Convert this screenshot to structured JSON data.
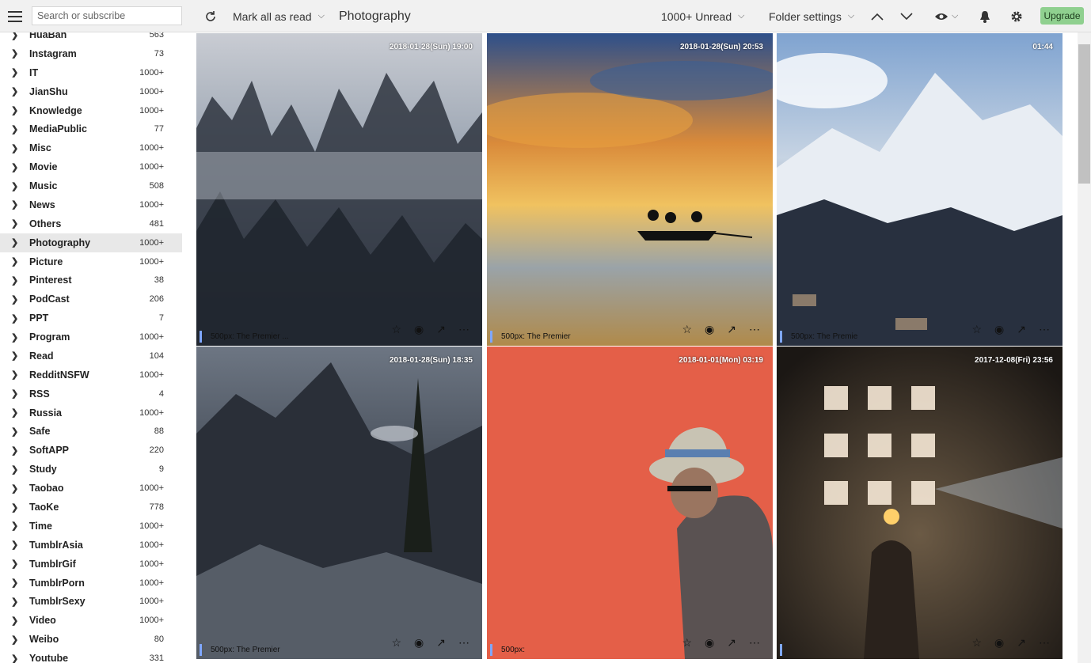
{
  "toolbar": {
    "search_placeholder": "Search or subscribe",
    "mark_all_label": "Mark all as read",
    "page_title": "Photography",
    "unread_label": "1000+ Unread",
    "folder_settings_label": "Folder settings",
    "upgrade_label": "Upgrade"
  },
  "sidebar": {
    "items": [
      {
        "label": "HuaBan",
        "count": "563"
      },
      {
        "label": "Instagram",
        "count": "73"
      },
      {
        "label": "IT",
        "count": "1000+"
      },
      {
        "label": "JianShu",
        "count": "1000+"
      },
      {
        "label": "Knowledge",
        "count": "1000+"
      },
      {
        "label": "MediaPublic",
        "count": "77"
      },
      {
        "label": "Misc",
        "count": "1000+"
      },
      {
        "label": "Movie",
        "count": "1000+"
      },
      {
        "label": "Music",
        "count": "508"
      },
      {
        "label": "News",
        "count": "1000+"
      },
      {
        "label": "Others",
        "count": "481"
      },
      {
        "label": "Photography",
        "count": "1000+",
        "active": true
      },
      {
        "label": "Picture",
        "count": "1000+"
      },
      {
        "label": "Pinterest",
        "count": "38"
      },
      {
        "label": "PodCast",
        "count": "206"
      },
      {
        "label": "PPT",
        "count": "7"
      },
      {
        "label": "Program",
        "count": "1000+"
      },
      {
        "label": "Read",
        "count": "104"
      },
      {
        "label": "RedditNSFW",
        "count": "1000+"
      },
      {
        "label": "RSS",
        "count": "4"
      },
      {
        "label": "Russia",
        "count": "1000+"
      },
      {
        "label": "Safe",
        "count": "88"
      },
      {
        "label": "SoftAPP",
        "count": "220"
      },
      {
        "label": "Study",
        "count": "9"
      },
      {
        "label": "Taobao",
        "count": "1000+"
      },
      {
        "label": "TaoKe",
        "count": "778"
      },
      {
        "label": "Time",
        "count": "1000+"
      },
      {
        "label": "TumblrAsia",
        "count": "1000+"
      },
      {
        "label": "TumblrGif",
        "count": "1000+"
      },
      {
        "label": "TumblrPorn",
        "count": "1000+"
      },
      {
        "label": "TumblrSexy",
        "count": "1000+"
      },
      {
        "label": "Video",
        "count": "1000+"
      },
      {
        "label": "Weibo",
        "count": "80"
      },
      {
        "label": "Youtube",
        "count": "331"
      }
    ]
  },
  "cards": [
    {
      "timestamp": "2018-01-28(Sun) 19:00",
      "caption": "500px: The Premier ...",
      "theme": "mist-rocks"
    },
    {
      "timestamp": "2018-01-28(Sun) 20:53",
      "caption": "500px: The Premier",
      "theme": "sunset-boat"
    },
    {
      "timestamp": "01:44",
      "caption": "500px: The Premie",
      "theme": "snow-mountain"
    },
    {
      "timestamp": "2018-01-28(Sun) 18:35",
      "caption": "500px: The Premier",
      "theme": "dark-peaks"
    },
    {
      "timestamp": "2018-01-01(Mon) 03:19",
      "caption": "500px:",
      "theme": "hat-man"
    },
    {
      "timestamp": "2017-12-08(Fri) 23:56",
      "caption": "",
      "theme": "temple-light"
    }
  ],
  "icons": {
    "menu": "hamburger-icon",
    "refresh": "refresh-icon",
    "up": "chevron-up-icon",
    "down": "chevron-down-icon",
    "eye": "eye-icon",
    "bell": "bell-icon",
    "gear": "gear-icon",
    "star": "star-icon",
    "read": "mark-read-icon",
    "open": "open-external-icon",
    "more": "more-icon"
  },
  "colors": {
    "accent_bar": "#7fa7ff",
    "upgrade_bg": "#8fd08f",
    "active_row": "#e8e8e8"
  }
}
